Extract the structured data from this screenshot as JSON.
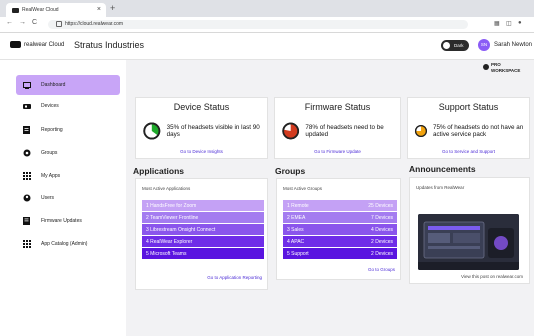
{
  "browser": {
    "tab_title": "RealWear Cloud",
    "tab_close": "×",
    "new_tab": "+",
    "url": "https://cloud.realwear.com",
    "nav_back": "←",
    "nav_forward": "→",
    "nav_reload": "C"
  },
  "header": {
    "brand": "realwear Cloud",
    "company": "Stratus Industries",
    "dark_toggle": "Dark",
    "user_initials": "SN",
    "user_name": "Sarah Newton"
  },
  "sidebar": {
    "items": [
      {
        "label": "Dashboard",
        "icon": "monitor-icon",
        "active": true
      },
      {
        "label": "Devices",
        "icon": "device-icon",
        "active": false
      },
      {
        "label": "Reporting",
        "icon": "report-icon",
        "active": false
      },
      {
        "label": "Groups",
        "icon": "groups-icon",
        "active": false
      },
      {
        "label": "My Apps",
        "icon": "apps-icon",
        "active": false
      },
      {
        "label": "Users",
        "icon": "users-icon",
        "active": false
      },
      {
        "label": "Firmware Updates",
        "icon": "firmware-icon",
        "active": false
      },
      {
        "label": "App Catalog (Admin)",
        "icon": "catalog-icon",
        "active": false
      }
    ]
  },
  "workspace": {
    "line1": "PRO",
    "line2": "WORKSPACE"
  },
  "status_cards": [
    {
      "title": "Device Status",
      "text": "35% of headsets visible in last 90 days",
      "percent": 35,
      "color": "#1faa2b",
      "link": "Go to Device Insights"
    },
    {
      "title": "Firmware Status",
      "text": "78% of headsets need to be updated",
      "percent": 78,
      "color": "#d23b1f",
      "link": "Go to Firmware Update"
    },
    {
      "title": "Support Status",
      "text": "75% of headsets do not have an active service pack",
      "percent": 75,
      "color": "#f2a30f",
      "link": "Go to Service and Support"
    }
  ],
  "applications": {
    "heading": "Applications",
    "subheading": "Most Active Applications",
    "items": [
      "1  HandsFree for Zoom",
      "2  TeamViewer Frontline",
      "3  Librestream Onsight Connect",
      "4  RealWear Explorer",
      "5  Microsoft Teams"
    ],
    "link": "Go to Application Reporting"
  },
  "groups": {
    "heading": "Groups",
    "subheading": "Most Active Groups",
    "items": [
      {
        "name": "1  Remote",
        "count": "25 Devices"
      },
      {
        "name": "2  EMEA",
        "count": "7 Devices"
      },
      {
        "name": "3  Sales",
        "count": "4 Devices"
      },
      {
        "name": "4  APAC",
        "count": "2 Devices"
      },
      {
        "name": "5  Support",
        "count": "2 Devices"
      }
    ],
    "link": "Go to Groups"
  },
  "announcements": {
    "heading": "Announcements",
    "subheading": "Updates from RealWear",
    "link": "View this post on realwear.com"
  },
  "colors": {
    "accent": "#4b2bd6",
    "active_nav": "#c8a5f7",
    "row_shades": [
      "#c4a1f5",
      "#a47cf0",
      "#8a55ec",
      "#6f2de8",
      "#5a14e0"
    ]
  }
}
